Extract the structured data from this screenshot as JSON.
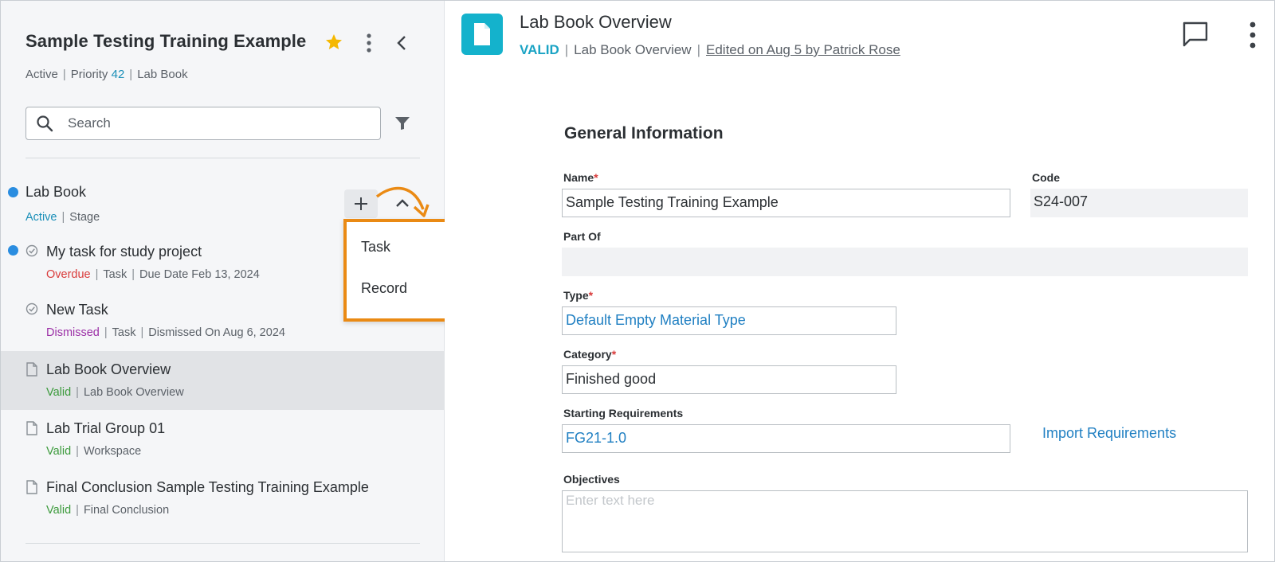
{
  "sidebar": {
    "project_title": "Sample Testing Training Example",
    "meta": {
      "status": "Active",
      "priority_label": "Priority",
      "priority_value": "42",
      "type": "Lab Book"
    },
    "search": {
      "placeholder": "Search"
    },
    "group": {
      "title": "Lab Book",
      "status": "Active",
      "type": "Stage"
    },
    "items": [
      {
        "title": "My task for study project",
        "status": "Overdue",
        "type": "Task",
        "detail": "Due Date Feb 13, 2024"
      },
      {
        "title": "New Task",
        "status": "Dismissed",
        "type": "Task",
        "detail": "Dismissed On Aug 6, 2024"
      },
      {
        "title": "Lab Book Overview",
        "status": "Valid",
        "type": "Lab Book Overview"
      },
      {
        "title": "Lab Trial Group 01",
        "status": "Valid",
        "type": "Workspace"
      },
      {
        "title": "Final Conclusion Sample Testing Training Example",
        "status": "Valid",
        "type": "Final Conclusion"
      }
    ],
    "add_menu": {
      "items": [
        {
          "label": "Task"
        },
        {
          "label": "Record"
        }
      ]
    }
  },
  "main": {
    "title": "Lab Book Overview",
    "status_badge": "VALID",
    "subtitle": "Lab Book Overview",
    "edited": "Edited on Aug 5 by Patrick Rose",
    "section_title": "General Information",
    "fields": {
      "name": {
        "label": "Name",
        "value": "Sample Testing Training Example"
      },
      "code": {
        "label": "Code",
        "value": "S24-007"
      },
      "part_of": {
        "label": "Part Of",
        "value": ""
      },
      "type": {
        "label": "Type",
        "value": "Default Empty Material Type"
      },
      "category": {
        "label": "Category",
        "value": "Finished good"
      },
      "starting_requirements": {
        "label": "Starting Requirements",
        "value": "FG21-1.0"
      },
      "objectives": {
        "label": "Objectives",
        "placeholder": "Enter text here"
      }
    },
    "import_link": "Import Requirements",
    "required_marker": "*"
  },
  "colors": {
    "accent": "#1aa3c4",
    "highlight": "#ea8a14",
    "star": "#f5b800",
    "dot": "#2a8de0"
  }
}
